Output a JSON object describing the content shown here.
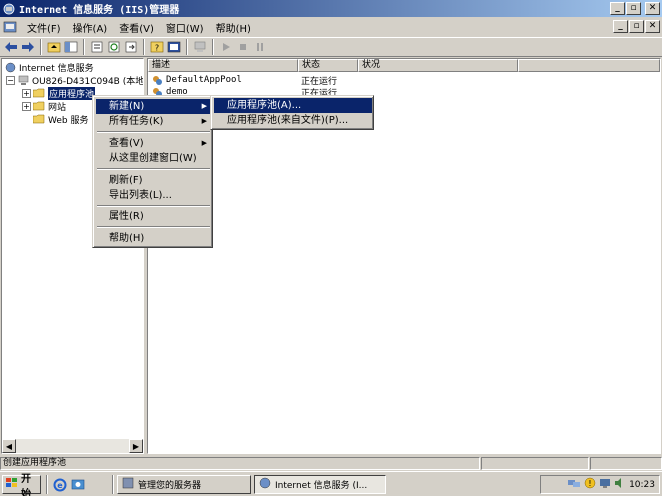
{
  "window": {
    "title": "Internet 信息服务 (IIS)管理器"
  },
  "menubar": {
    "items": [
      "文件(F)",
      "操作(A)",
      "查看(V)",
      "窗口(W)",
      "帮助(H)"
    ]
  },
  "tree": {
    "root": "Internet 信息服务",
    "server": "OU826-D431C094B (本地计",
    "app_pools": "应用程序池",
    "websites": "网站",
    "web_ext": "Web 服务"
  },
  "list": {
    "columns": [
      "描述",
      "状态",
      "状况"
    ],
    "rows": [
      {
        "name": "DefaultAppPool",
        "status": "正在运行",
        "state": ""
      },
      {
        "name": "demo",
        "status": "正在运行",
        "state": ""
      }
    ]
  },
  "context_menu": {
    "new": "新建(N)",
    "all_tasks": "所有任务(K)",
    "view": "查看(V)",
    "new_window": "从这里创建窗口(W)",
    "refresh": "刷新(F)",
    "export": "导出列表(L)...",
    "properties": "属性(R)",
    "help": "帮助(H)"
  },
  "submenu": {
    "app_pool": "应用程序池(A)...",
    "app_pool_file": "应用程序池(来自文件)(P)..."
  },
  "statusbar": {
    "text": "创建应用程序池"
  },
  "taskbar": {
    "start": "开始",
    "task1": "管理您的服务器",
    "task2": "Internet 信息服务 (I...",
    "clock": "10:23"
  },
  "colors": {
    "selection": "#0a246a",
    "face": "#d4d0c8"
  }
}
